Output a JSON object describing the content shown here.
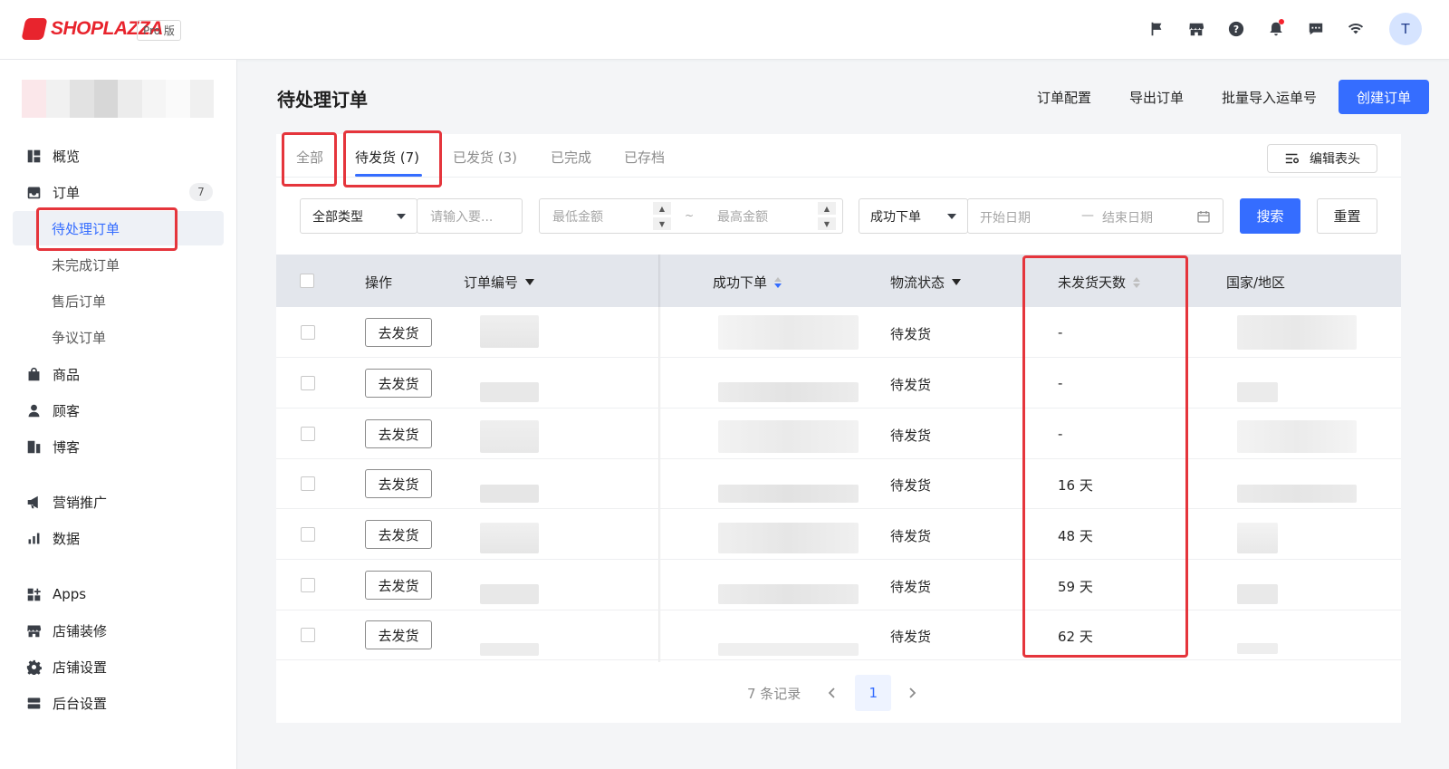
{
  "header": {
    "logo_text": "SHOPLAZZA",
    "plan_badge": "Pro 版",
    "avatar_initial": "T",
    "icons": [
      "flag-icon",
      "store-icon",
      "help-icon",
      "bell-icon",
      "message-icon",
      "wifi-icon"
    ]
  },
  "sidebar": {
    "items": [
      {
        "label": "概览",
        "icon": "dashboard-icon"
      },
      {
        "label": "订单",
        "icon": "inbox-icon",
        "count": "7"
      },
      {
        "label": "待处理订单",
        "sub": true,
        "active": true
      },
      {
        "label": "未完成订单",
        "sub": true
      },
      {
        "label": "售后订单",
        "sub": true
      },
      {
        "label": "争议订单",
        "sub": true
      },
      {
        "label": "商品",
        "icon": "bag-icon"
      },
      {
        "label": "顾客",
        "icon": "person-icon"
      },
      {
        "label": "博客",
        "icon": "blog-icon"
      },
      {
        "label": "营销推广",
        "icon": "megaphone-icon"
      },
      {
        "label": "数据",
        "icon": "bar-chart-icon"
      },
      {
        "label": "Apps",
        "icon": "apps-icon"
      },
      {
        "label": "店铺装修",
        "icon": "store-icon"
      },
      {
        "label": "店铺设置",
        "icon": "gear-icon"
      },
      {
        "label": "后台设置",
        "icon": "server-icon"
      }
    ]
  },
  "page": {
    "title": "待处理订单",
    "actions": {
      "config": "订单配置",
      "export": "导出订单",
      "bulk_import": "批量导入运单号",
      "create": "创建订单"
    }
  },
  "tabs": [
    {
      "label": "全部"
    },
    {
      "label": "待发货 (7)",
      "active": true
    },
    {
      "label": "已发货 (3)"
    },
    {
      "label": "已完成"
    },
    {
      "label": "已存档"
    }
  ],
  "edit_header_label": "编辑表头",
  "filters": {
    "type_select": "全部类型",
    "keyword_placeholder": "请输入要...",
    "min_amount_placeholder": "最低金额",
    "range_sep": "~",
    "max_amount_placeholder": "最高金额",
    "date_type_select": "成功下单",
    "start_date_placeholder": "开始日期",
    "date_sep": "—",
    "end_date_placeholder": "结束日期",
    "search_label": "搜索",
    "reset_label": "重置"
  },
  "table": {
    "columns": [
      "操作",
      "订单编号",
      "成功下单",
      "物流状态",
      "未发货天数",
      "国家/地区"
    ],
    "rows": [
      {
        "action": "去发货",
        "status": "待发货",
        "days": "-"
      },
      {
        "action": "去发货",
        "status": "待发货",
        "days": "-"
      },
      {
        "action": "去发货",
        "status": "待发货",
        "days": "-"
      },
      {
        "action": "去发货",
        "status": "待发货",
        "days": "16 天"
      },
      {
        "action": "去发货",
        "status": "待发货",
        "days": "48 天"
      },
      {
        "action": "去发货",
        "status": "待发货",
        "days": "59 天"
      },
      {
        "action": "去发货",
        "status": "待发货",
        "days": "62 天"
      }
    ]
  },
  "pagination": {
    "records": "7 条记录",
    "current_page": "1"
  },
  "colors": {
    "accent": "#356dff",
    "brand": "#e8242d",
    "highlight": "#e5353c"
  }
}
